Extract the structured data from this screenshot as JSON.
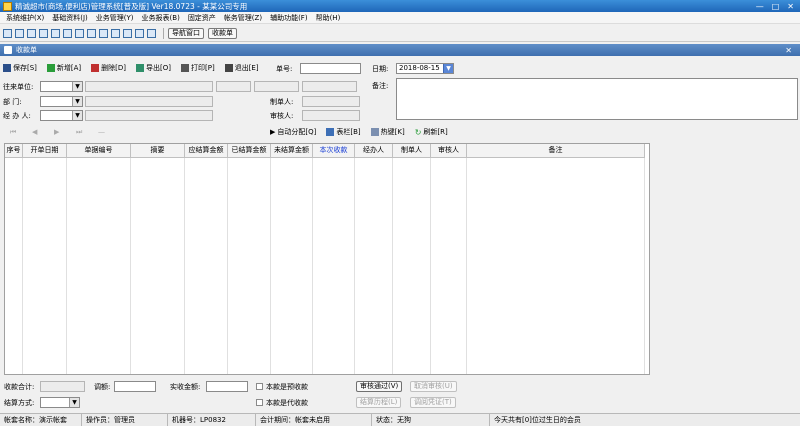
{
  "window": {
    "title": "精诚超市(商场,便利店)管理系统[普及版] Ver18.0723 - 某某公司专用",
    "min": "—",
    "max": "□",
    "close": "✕"
  },
  "menu": [
    "系统维护(X)",
    "基础资料(J)",
    "业务管理(Y)",
    "业务报表(B)",
    "固定资产",
    "帐务管理(Z)",
    "辅助功能(F)",
    "帮助(H)"
  ],
  "toolbar": {
    "nav_button": "导航窗口",
    "receipt_button": "收款单"
  },
  "subwindow": {
    "title": "收款单",
    "close": "✕"
  },
  "actions": {
    "save": "保存[S]",
    "add": "新增[A]",
    "delete": "删除[D]",
    "export": "导出[O]",
    "print": "打印[P]",
    "exit": "退出[E]"
  },
  "form": {
    "doc_no_label": "单号:",
    "doc_no_value": "",
    "date_label": "日期:",
    "date_value": "2018-08-15",
    "partner_label": "往来单位:",
    "dept_label": "部    门:",
    "handler_label": "经 办 人:",
    "maker_label": "制单人:",
    "reviewer_label": "审核人:",
    "remark_label": "备注:"
  },
  "nav_actions": {
    "auto_allocate": "自动分配[Q]",
    "columns": "表栏[B]",
    "hotkeys": "热键[K]",
    "refresh": "刷新[R]"
  },
  "grid": {
    "columns": [
      "序号",
      "开单日期",
      "单据编号",
      "摘要",
      "应结算金额",
      "已结算金额",
      "未结算金额",
      "本次收款",
      "经办人",
      "制单人",
      "审核人",
      "备注"
    ],
    "highlight_index": 7
  },
  "bottom": {
    "total_label": "收款合计:",
    "adjust_label": "调额:",
    "actual_label": "实收金额:",
    "prepay_label": "本款是预收款",
    "settle_label": "结算方式:",
    "proxy_label": "本款是代收款",
    "review_pass": "审核通过(V)",
    "cancel_review": "取消审核(U)",
    "settle_history": "结算历程(L)",
    "adjust_voucher": "调阅凭证(T)"
  },
  "statusbar": {
    "account": "帐套名称：演示帐套",
    "operator": "操作员：管理员",
    "machine": "机器号：LP0832",
    "period": "会计期间：帐套未启用",
    "state": "状态：无狗",
    "birthday": "今天共有[0]位过生日的会员"
  }
}
